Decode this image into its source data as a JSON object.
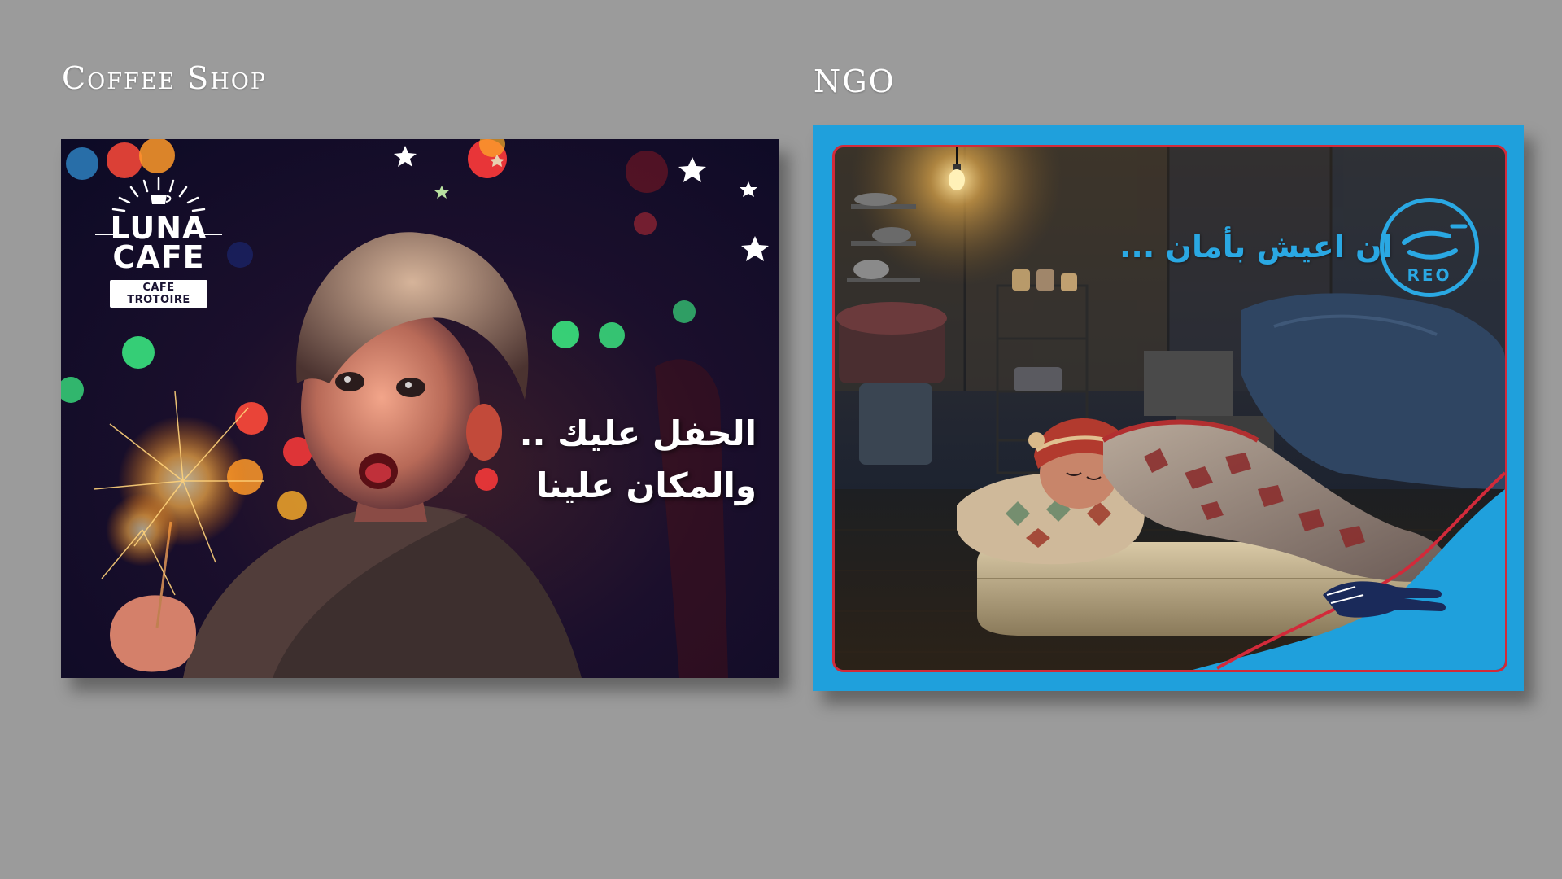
{
  "labels": {
    "left": "Coffee Shop",
    "right": "NGO"
  },
  "cafe": {
    "logo": {
      "line1": "LUNA",
      "line2": "CAFE",
      "sub": "CAFE TROTOIRE"
    },
    "headline_line1": "الحفل عليك ..",
    "headline_line2": "والمكان علينا",
    "colors": {
      "background": "#0c0a25",
      "accent_orange": "#ff8a1c"
    }
  },
  "ngo": {
    "headline": "ان اعيش بأمان ...",
    "logo_text": "REO",
    "colors": {
      "frame_blue": "#1fa0dc",
      "inner_border_red": "#d22a3a",
      "text_blue": "#2aa8e3"
    },
    "icons": [
      "hand-icon",
      "light-bulb-icon"
    ]
  }
}
